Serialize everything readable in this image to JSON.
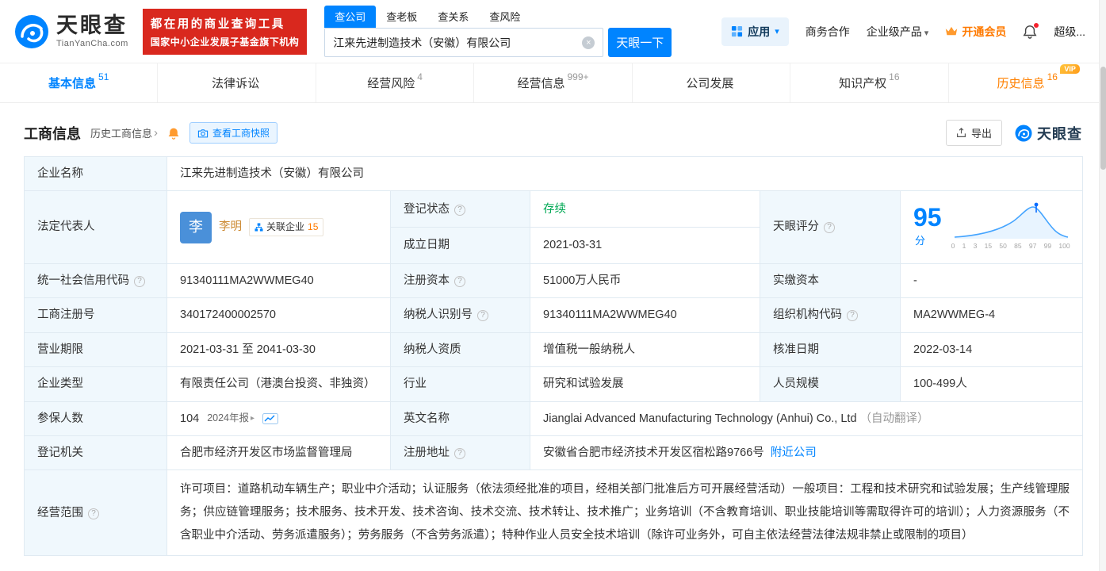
{
  "colors": {
    "brand_blue": "#0084ff",
    "banner_red": "#d9281e",
    "vip_orange": "#ff8000",
    "status_green": "#00a854",
    "label_cell_bg": "#f0f8fd"
  },
  "icons": {
    "help": "?",
    "caret_down": "▾",
    "chevron_right": "›",
    "clear": "×",
    "expand": "▸"
  },
  "header": {
    "logo": {
      "brand": "天眼查",
      "domain": "TianYanCha.com"
    },
    "slogan": {
      "line1": "都在用的商业查询工具",
      "line2": "国家中小企业发展子基金旗下机构"
    },
    "search": {
      "tabs": [
        {
          "label": "查公司"
        },
        {
          "label": "查老板"
        },
        {
          "label": "查关系"
        },
        {
          "label": "查风险"
        }
      ],
      "value": "江来先进制造技术（安徽）有限公司",
      "button": "天眼一下"
    },
    "menu": {
      "apps": "应用",
      "cooperation": "商务合作",
      "enterprise": "企业级产品",
      "vip": "开通会员",
      "super": "超级..."
    }
  },
  "tabs": [
    {
      "label": "基本信息",
      "count": "51"
    },
    {
      "label": "法律诉讼",
      "count": ""
    },
    {
      "label": "经营风险",
      "count": "4"
    },
    {
      "label": "经营信息",
      "count": "999+"
    },
    {
      "label": "公司发展",
      "count": ""
    },
    {
      "label": "知识产权",
      "count": "16"
    },
    {
      "label": "历史信息",
      "count": "16",
      "vip": "VIP"
    }
  ],
  "section": {
    "title": "工商信息",
    "history_link": "历史工商信息",
    "snapshot_button": "查看工商快照",
    "export_button": "导出",
    "brand": "天眼查"
  },
  "fields": {
    "company_name": {
      "label": "企业名称",
      "value": "江来先进制造技术（安徽）有限公司"
    },
    "legal_rep": {
      "label": "法定代表人",
      "avatar": "李",
      "name": "李明",
      "related_label": "关联企业",
      "related_count": "15"
    },
    "reg_status": {
      "label": "登记状态",
      "value": "存续"
    },
    "establish_date": {
      "label": "成立日期",
      "value": "2021-03-31"
    },
    "score": {
      "label": "天眼评分",
      "value": "95",
      "unit": "分",
      "ticks": [
        "0",
        "1",
        "3",
        "15",
        "50",
        "85",
        "97",
        "99",
        "100"
      ]
    },
    "credit_code": {
      "label": "统一社会信用代码",
      "value": "91340111MA2WWMEG40"
    },
    "reg_capital": {
      "label": "注册资本",
      "value": "51000万人民币"
    },
    "paid_capital": {
      "label": "实缴资本",
      "value": "-"
    },
    "reg_number": {
      "label": "工商注册号",
      "value": "340172400002570"
    },
    "taxpayer_id": {
      "label": "纳税人识别号",
      "value": "91340111MA2WWMEG40"
    },
    "org_code": {
      "label": "组织机构代码",
      "value": "MA2WWMEG-4"
    },
    "business_term": {
      "label": "营业期限",
      "value": "2021-03-31 至 2041-03-30"
    },
    "taxpayer_quality": {
      "label": "纳税人资质",
      "value": "增值税一般纳税人"
    },
    "approval_date": {
      "label": "核准日期",
      "value": "2022-03-14"
    },
    "company_type": {
      "label": "企业类型",
      "value": "有限责任公司（港澳台投资、非独资）"
    },
    "industry": {
      "label": "行业",
      "value": "研究和试验发展"
    },
    "staff_size": {
      "label": "人员规模",
      "value": "100-499人"
    },
    "insured": {
      "label": "参保人数",
      "value": "104",
      "report": "2024年报"
    },
    "english_name": {
      "label": "英文名称",
      "value": "Jianglai Advanced Manufacturing Technology (Anhui) Co., Ltd",
      "note": "（自动翻译）"
    },
    "reg_authority": {
      "label": "登记机关",
      "value": "合肥市经济开发区市场监督管理局"
    },
    "reg_address": {
      "label": "注册地址",
      "value": "安徽省合肥市经济技术开发区宿松路9766号",
      "nearby": "附近公司"
    },
    "business_scope": {
      "label": "经营范围",
      "value": "许可项目：道路机动车辆生产；职业中介活动；认证服务（依法须经批准的项目，经相关部门批准后方可开展经营活动）一般项目：工程和技术研究和试验发展；生产线管理服务；供应链管理服务；技术服务、技术开发、技术咨询、技术交流、技术转让、技术推广；业务培训（不含教育培训、职业技能培训等需取得许可的培训）；人力资源服务（不含职业中介活动、劳务派遣服务）；劳务服务（不含劳务派遣）；特种作业人员安全技术培训（除许可业务外，可自主依法经营法律法规非禁止或限制的项目）"
    }
  }
}
